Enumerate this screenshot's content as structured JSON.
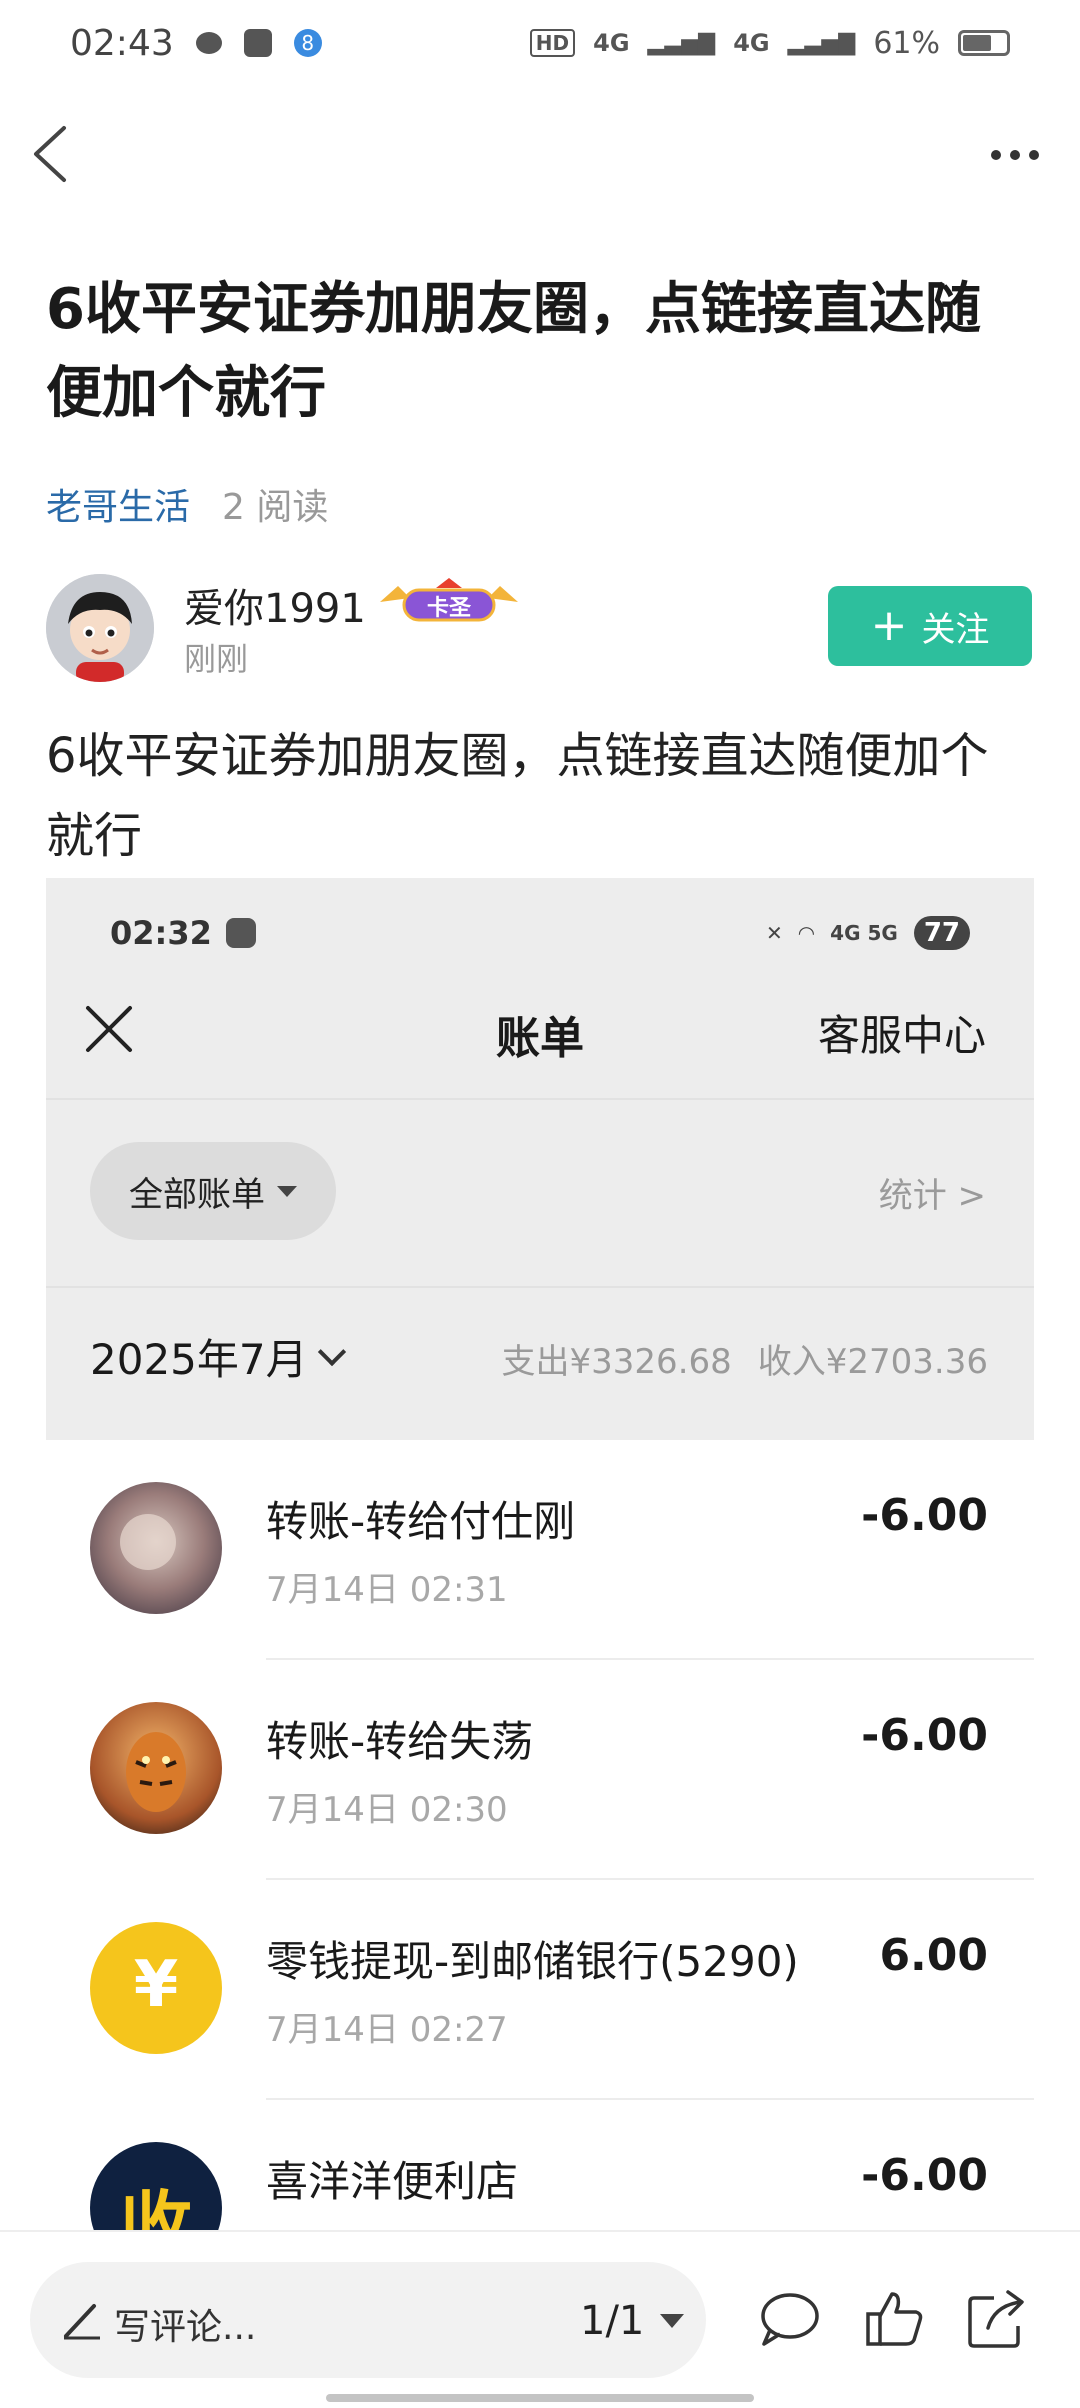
{
  "status_bar": {
    "time": "02:43",
    "signal1": "4G",
    "signal2": "4G",
    "battery": "61%"
  },
  "nav": {
    "back_icon": "back-chevron-icon",
    "more_icon": "more-dots-icon"
  },
  "article": {
    "title": "6收平安证券加朋友圈，点链接直达随便加个就行",
    "source": "老哥生活",
    "reads": "2 阅读",
    "body": "6收平安证券加朋友圈，点链接直达随便加个就行"
  },
  "author": {
    "name": "爱你1991",
    "badge": "卡圣",
    "time": "刚刚",
    "follow_label": "关注"
  },
  "screenshot": {
    "status_time": "02:32",
    "status_icons": "4G 5G",
    "battery": "77",
    "title": "账单",
    "service": "客服中心",
    "filter_label": "全部账单",
    "stats_label": "统计 >",
    "month": "2025年7月",
    "expense": "支出¥3326.68",
    "income": "收入¥2703.36",
    "transactions": [
      {
        "name": "转账-转给付仕刚",
        "time": "7月14日 02:31",
        "amount": "-6.00"
      },
      {
        "name": "转账-转给失荡",
        "time": "7月14日 02:30",
        "amount": "-6.00"
      },
      {
        "name": "零钱提现-到邮储银行(5290)",
        "time": "7月14日 02:27",
        "amount": "6.00"
      },
      {
        "name": "喜洋洋便利店",
        "time": "",
        "amount": "-6.00"
      }
    ],
    "yuan_symbol": "¥",
    "shop_glyph": "收"
  },
  "bottom_bar": {
    "comment_placeholder": "写评论...",
    "page_count": "1/1"
  },
  "colors": {
    "accent": "#2dbf9d",
    "link": "#2a6aa8"
  }
}
